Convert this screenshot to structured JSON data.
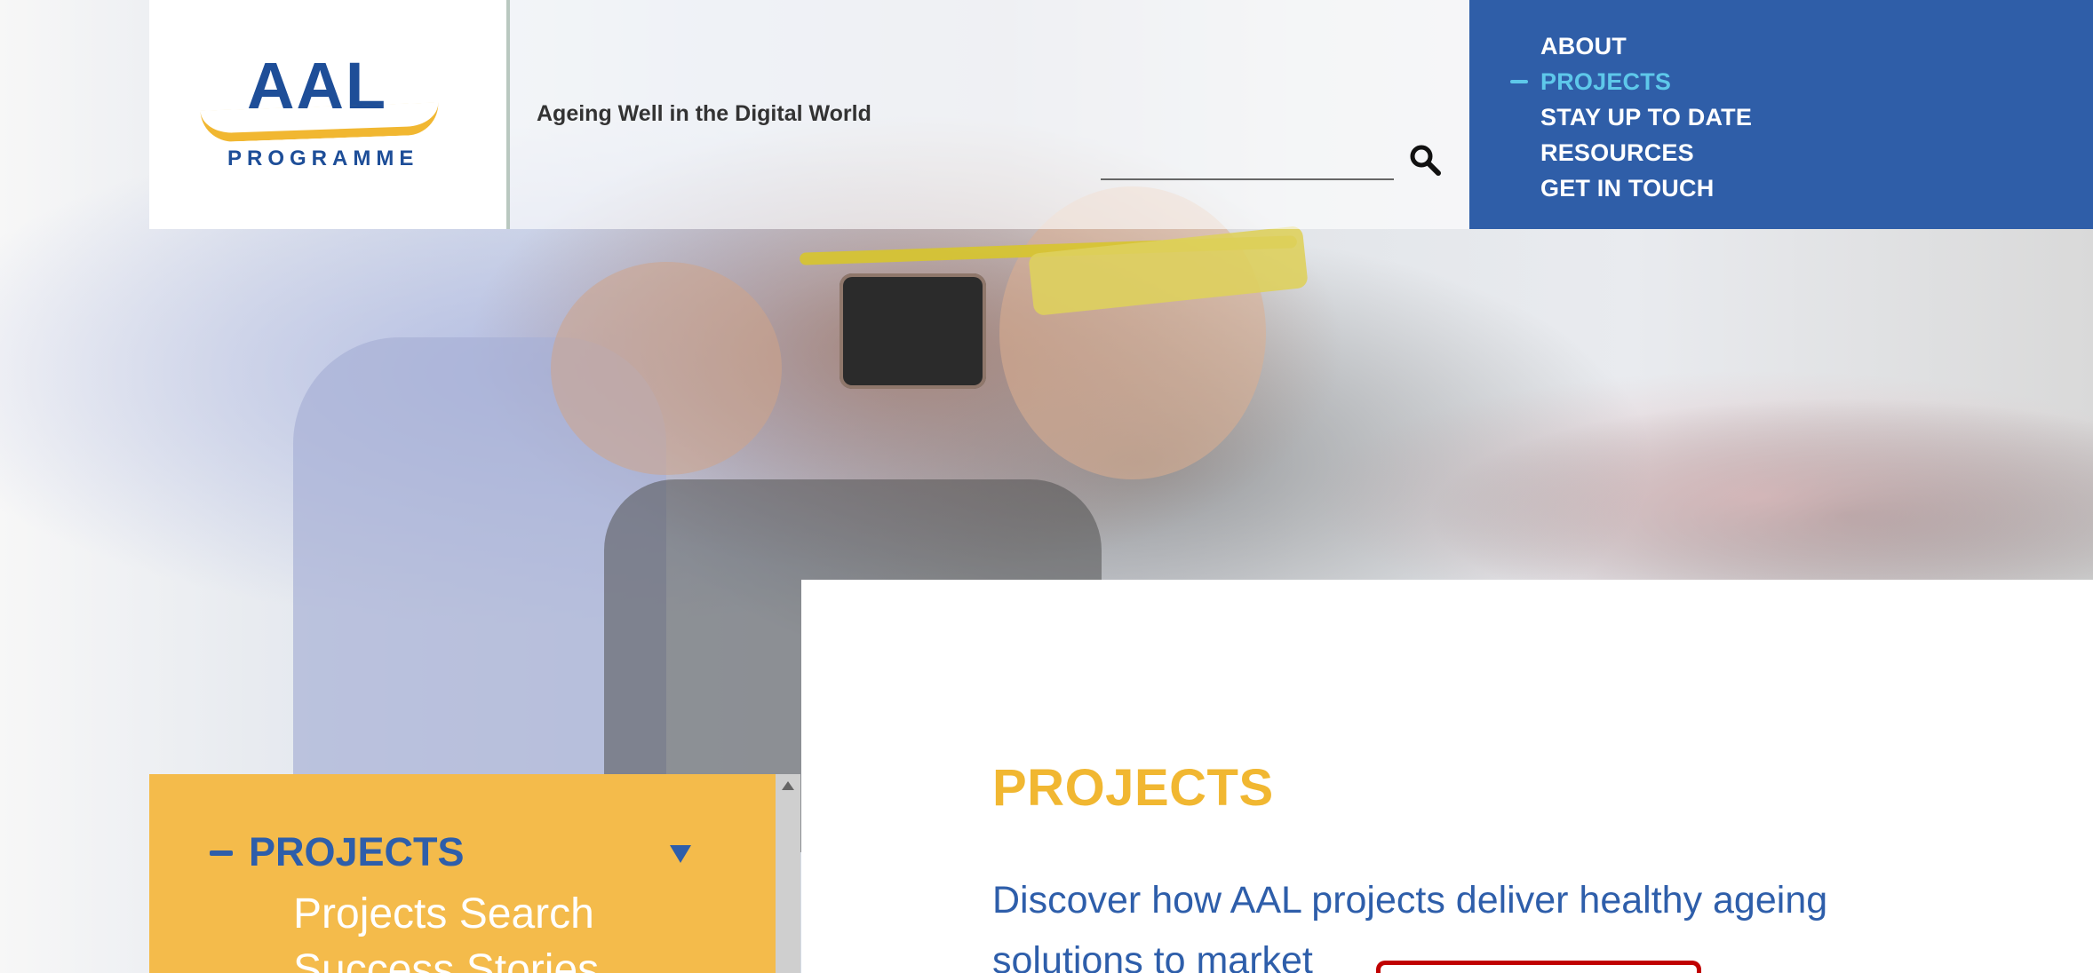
{
  "header": {
    "logo_main": "AAL",
    "logo_sub": "PROGRAMME",
    "tagline": "Ageing Well in the Digital World"
  },
  "navigation": {
    "items": [
      {
        "label": "ABOUT",
        "active": false
      },
      {
        "label": "PROJECTS",
        "active": true
      },
      {
        "label": "STAY UP TO DATE",
        "active": false
      },
      {
        "label": "RESOURCES",
        "active": false
      },
      {
        "label": "GET IN TOUCH",
        "active": false
      }
    ]
  },
  "side_menu": {
    "title": "PROJECTS",
    "links": [
      "Projects Search",
      "Success Stories"
    ]
  },
  "main": {
    "title": "PROJECTS",
    "subtitle": "Discover how AAL projects deliver healthy ageing solutions to market"
  },
  "colors": {
    "nav_bg": "#2f5ea8",
    "accent_yellow": "#f1b731",
    "text_blue": "#2e5eaa",
    "active_nav": "#5ec8ea",
    "side_panel": "#f4bb4b",
    "red_outline": "#c00000"
  },
  "icons": {
    "search": "search-icon",
    "menu_dash": "dash-icon",
    "expand": "caret-down-icon",
    "scroll": "scroll-up-icon"
  }
}
